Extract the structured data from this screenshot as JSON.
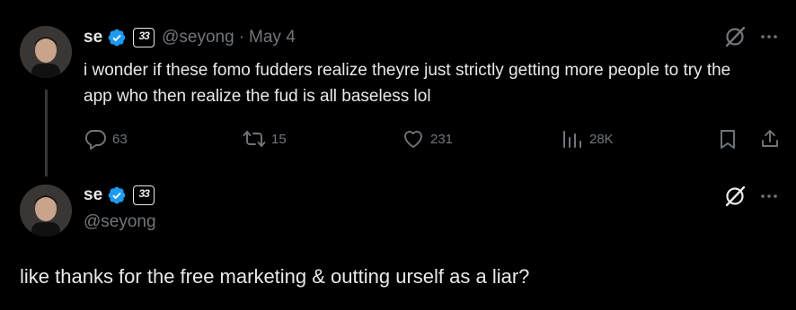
{
  "tweet": {
    "author_name": "se",
    "handle": "@seyong",
    "separator": "·",
    "date": "May 4",
    "affiliate_glyph": "33",
    "text": "i wonder if these fomo fudders realize theyre just strictly getting more people to try the app who then realize the fud is all baseless lol",
    "stats": {
      "replies": "63",
      "reposts": "15",
      "likes": "231",
      "views": "28K"
    }
  },
  "reply": {
    "author_name": "se",
    "handle": "@seyong",
    "affiliate_glyph": "33",
    "text": "like thanks for the free marketing & outting urself as a liar?"
  },
  "icons": {
    "verified": "verified-badge-icon",
    "affiliate": "affiliate-badge-icon",
    "grok": "grok-icon",
    "more": "more-icon",
    "reply": "reply-icon",
    "repost": "repost-icon",
    "like": "like-icon",
    "views": "views-icon",
    "bookmark": "bookmark-icon",
    "share": "share-icon"
  },
  "colors": {
    "background": "#000000",
    "text": "#e7e9ea",
    "muted": "#71767b",
    "verified_blue": "#1d9bf0"
  }
}
